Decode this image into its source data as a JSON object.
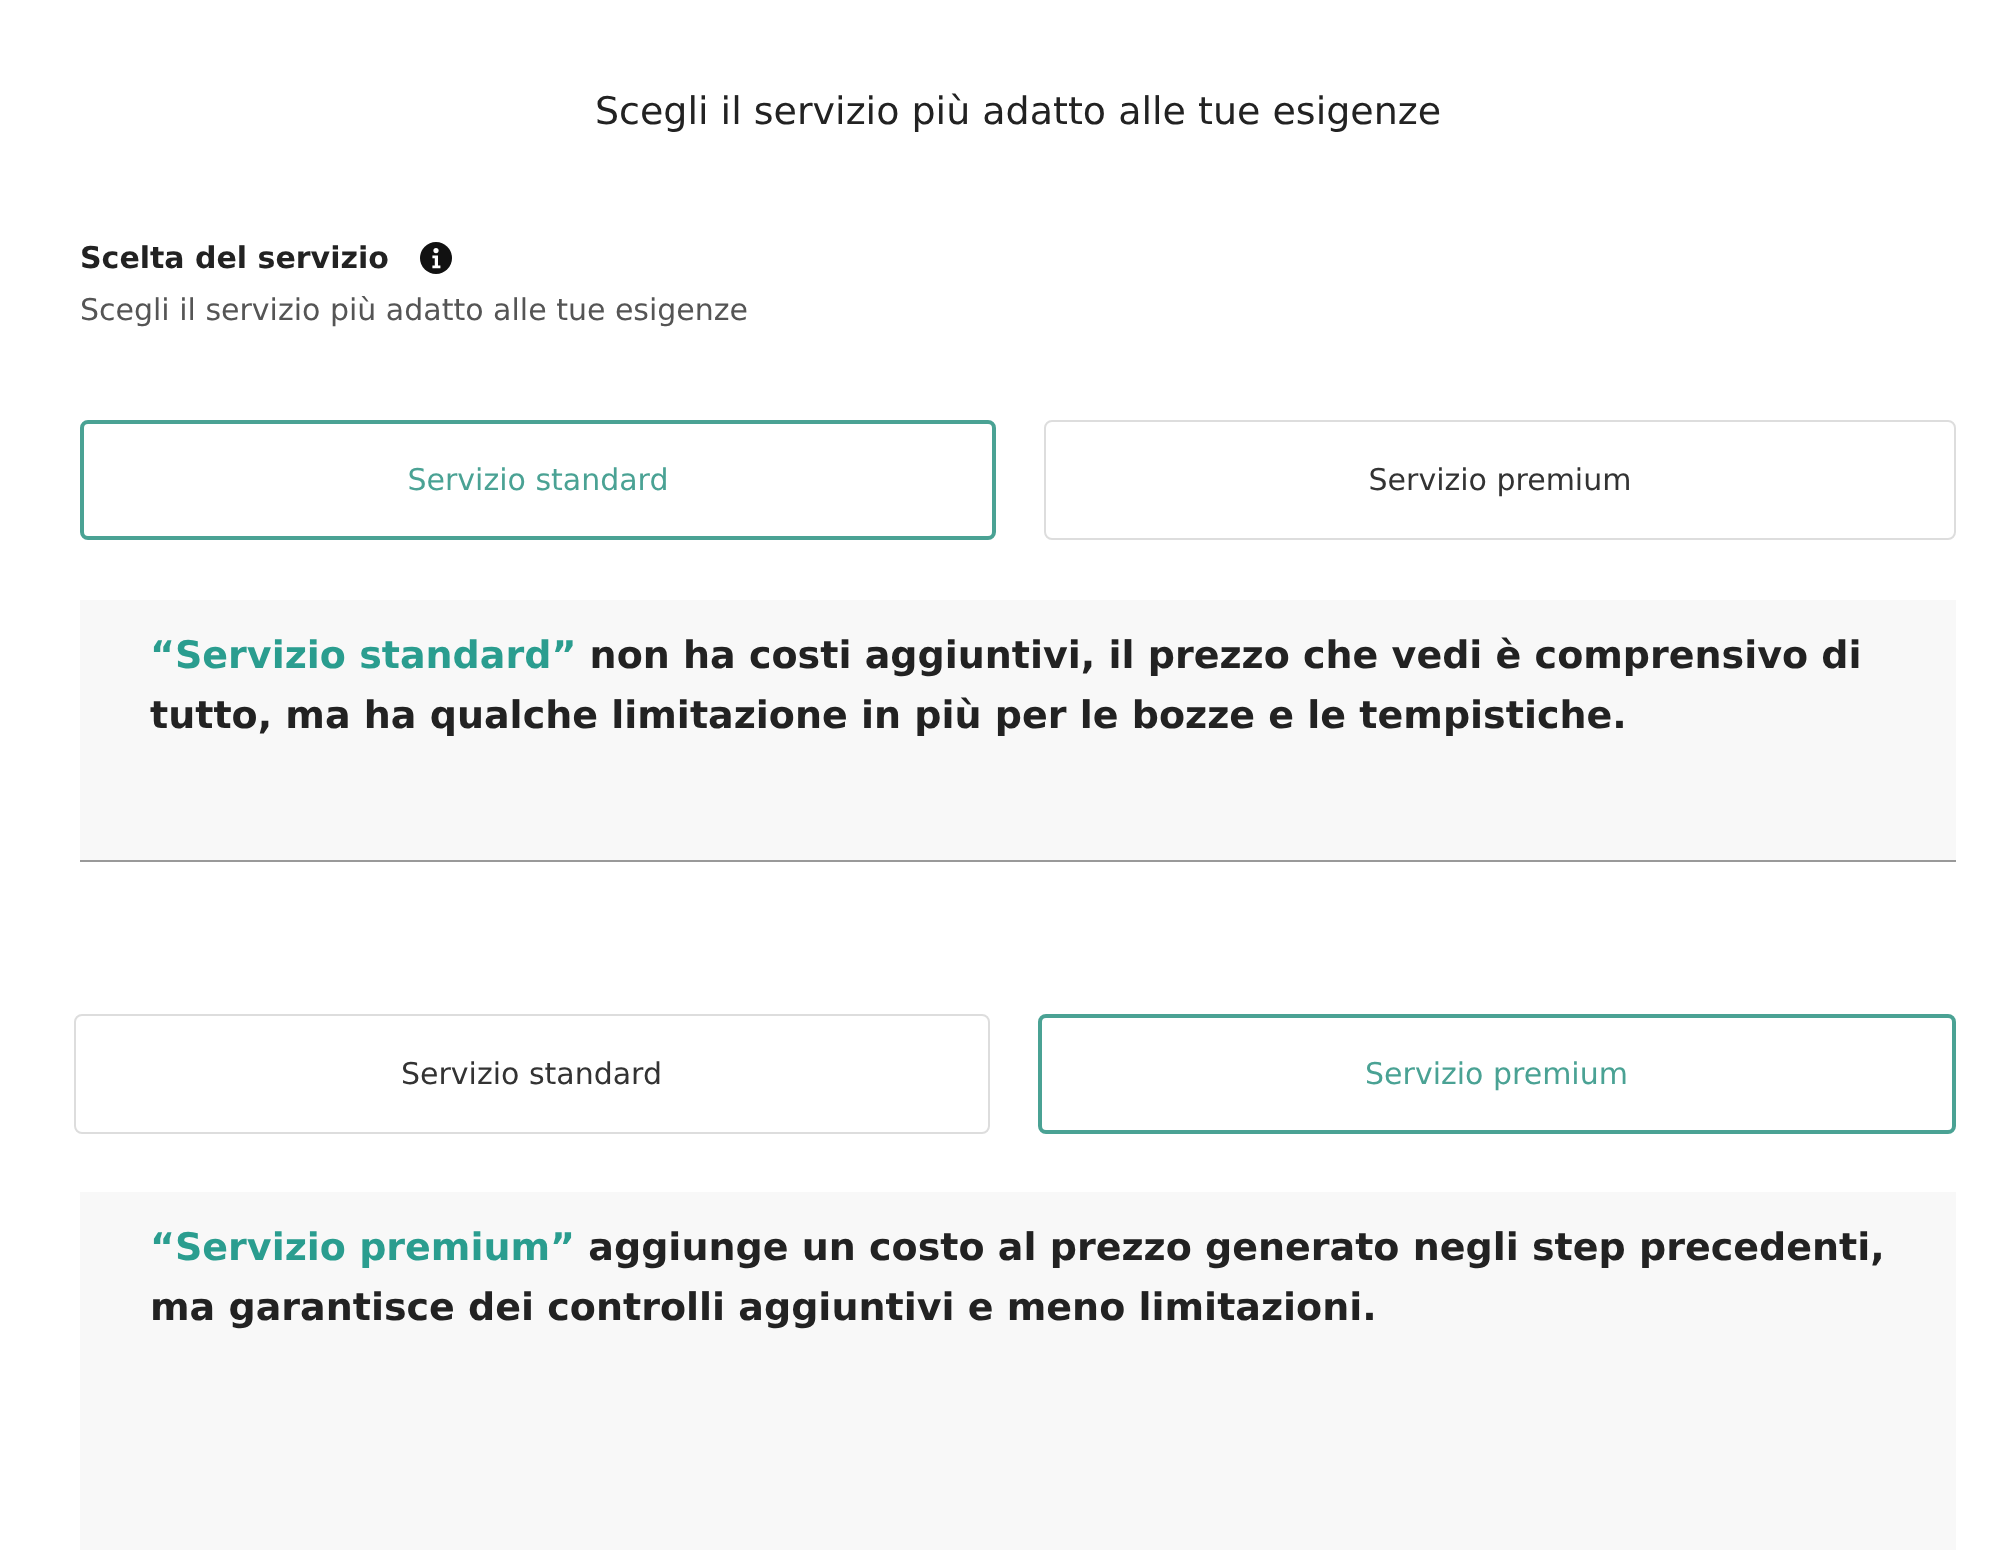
{
  "title": "Scegli il servizio più adatto alle tue esigenze",
  "section": {
    "heading": "Scelta del servizio",
    "subtitle": "Scegli il servizio più adatto alle tue esigenze"
  },
  "panels": [
    {
      "options": [
        {
          "label": "Servizio standard",
          "selected": true
        },
        {
          "label": "Servizio premium",
          "selected": false
        }
      ],
      "description": {
        "highlight": "“Servizio standard”",
        "text": "non ha costi aggiuntivi, il prezzo che vedi è comprensivo di tutto, ma ha qualche limitazione in più per le bozze e le tempistiche."
      }
    },
    {
      "options": [
        {
          "label": "Servizio standard",
          "selected": false
        },
        {
          "label": "Servizio premium",
          "selected": true
        }
      ],
      "description": {
        "highlight": "“Servizio premium”",
        "text": "aggiunge un costo al prezzo generato negli step precedenti, ma garantisce dei controlli aggiuntivi e meno limitazioni."
      }
    }
  ]
}
